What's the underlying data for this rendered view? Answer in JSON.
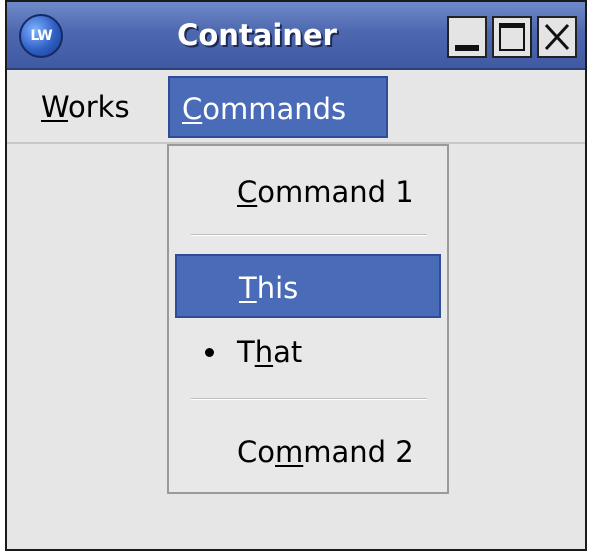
{
  "window": {
    "title": "Container",
    "app_icon_label": "LW",
    "controls": {
      "minimize_icon": "minimize-icon",
      "maximize_icon": "maximize-icon",
      "close_icon": "close-icon"
    }
  },
  "menubar": {
    "items": [
      {
        "label_first": "W",
        "label_rest": "orks"
      },
      {
        "label_first": "C",
        "label_rest": "ommands",
        "state": "open"
      }
    ]
  },
  "dropdown": {
    "command1": {
      "label_first": "C",
      "label_rest": "ommand 1"
    },
    "this": {
      "label_first": "T",
      "label_rest": "his",
      "state": "highlighted"
    },
    "that": {
      "label_pre": "T",
      "label_mnemonic": "h",
      "label_post": "at",
      "selected": true
    },
    "command2": {
      "label_pre": "Co",
      "label_mnemonic": "m",
      "label_post": "mand 2"
    }
  },
  "colors": {
    "titlebar": "#4e68b0",
    "highlight": "#4a6bb8",
    "background": "#e6e6e6"
  }
}
